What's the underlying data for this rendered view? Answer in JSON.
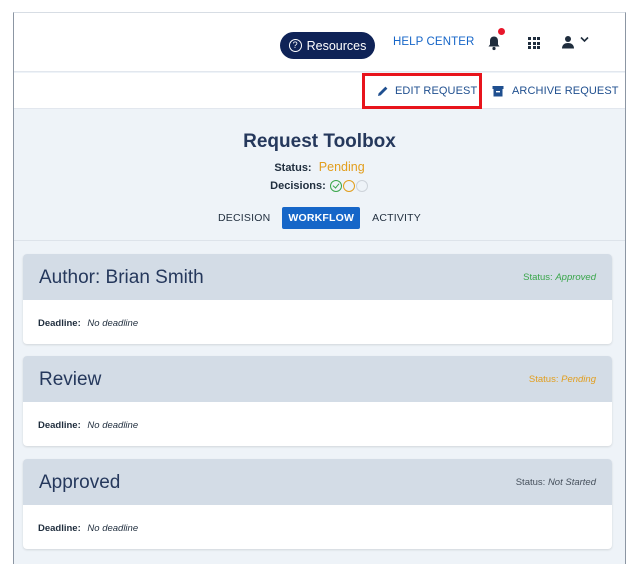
{
  "header": {
    "resources_label": "Resources",
    "help_center_label": "HELP CENTER",
    "has_notification": true
  },
  "actions": {
    "edit_request_label": "EDIT REQUEST",
    "archive_request_label": "ARCHIVE REQUEST"
  },
  "toolbox": {
    "title": "Request Toolbox",
    "status_label": "Status:",
    "status_value": "Pending",
    "decisions_label": "Decisions:",
    "decisions": [
      "approved",
      "pending",
      "not-started"
    ],
    "tabs": [
      {
        "label": "DECISION",
        "active": false
      },
      {
        "label": "WORKFLOW",
        "active": true
      },
      {
        "label": "ACTIVITY",
        "active": false
      }
    ]
  },
  "workflow": [
    {
      "title": "Author: Brian Smith",
      "status_label": "Status:",
      "status_value": "Approved",
      "deadline_label": "Deadline:",
      "deadline_value": "No deadline"
    },
    {
      "title": "Review",
      "status_label": "Status:",
      "status_value": "Pending",
      "deadline_label": "Deadline:",
      "deadline_value": "No deadline"
    },
    {
      "title": "Approved",
      "status_label": "Status:",
      "status_value": "Not Started",
      "deadline_label": "Deadline:",
      "deadline_value": "No deadline"
    }
  ],
  "colors": {
    "brand_navy": "#0f2357",
    "link_blue": "#1666c8",
    "approved_green": "#3aa64b",
    "pending_orange": "#e29e1d",
    "highlight_red": "#e8141c"
  }
}
